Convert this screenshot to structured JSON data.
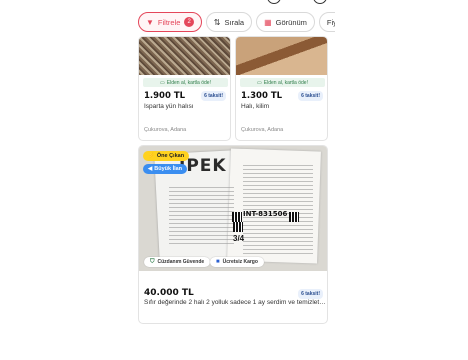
{
  "filter_bar": {
    "filter_label": "Filtrele",
    "filter_count": "2",
    "sort_label": "Sırala",
    "view_label": "Görünüm",
    "price_label": "Fiy"
  },
  "listings": [
    {
      "promo": "Elden al, kartla öde!",
      "price": "1.900 TL",
      "installments": "6 taksit!",
      "title": "Isparta yün halısı",
      "location": "Çukurova, Adana"
    },
    {
      "promo": "Elden al, kartla öde!",
      "price": "1.300 TL",
      "installments": "6 taksit!",
      "title": "Halı, kilim",
      "location": "Çukurova, Adana"
    },
    {
      "badge_featured": "Öne Çıkan",
      "badge_big": "Büyük İlan",
      "pill_wallet": "Cüzdanım Güvende",
      "pill_shipping": "Ücretsiz Kargo",
      "image_logo": "İPEK",
      "image_code": "INT-831506",
      "image_size": "3/4",
      "price": "40.000 TL",
      "installments": "6 taksit!",
      "title": "Sıfır değerinde 2 halı 2 yolluk sadece 1 ay serdim ve temizlett..."
    }
  ],
  "colors": {
    "accent": "#e4465a",
    "featured": "#ffd21f",
    "big_ad": "#3b8ef0"
  }
}
